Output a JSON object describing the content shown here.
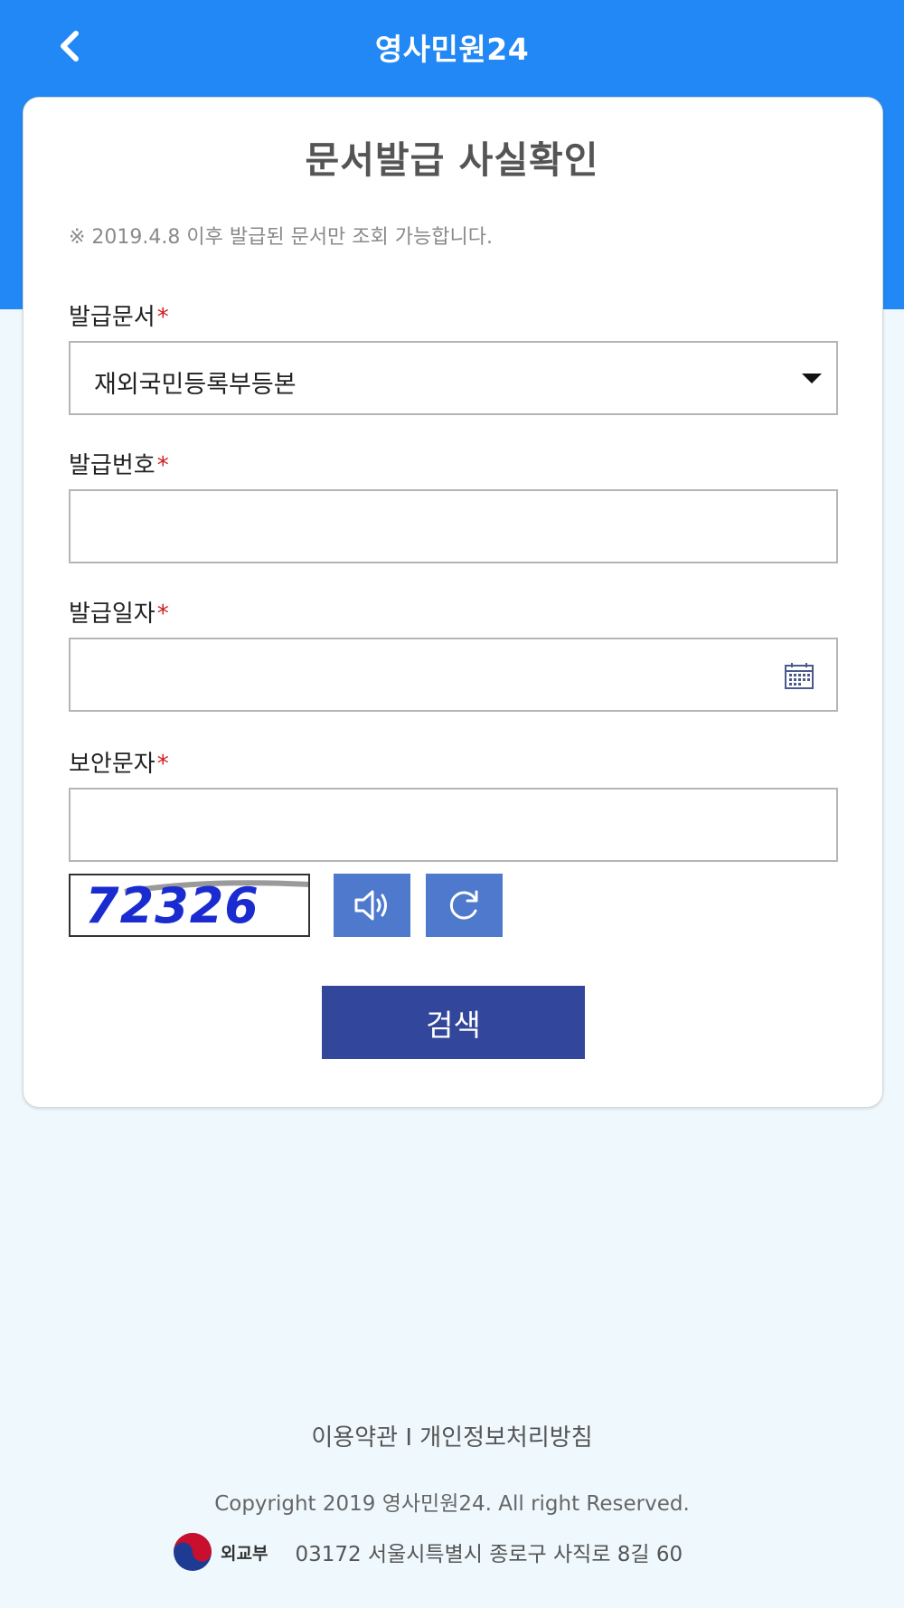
{
  "header": {
    "title": "영사민원24",
    "back_icon": "chevron-left-icon"
  },
  "card": {
    "title": "문서발급 사실확인",
    "notice": "※ 2019.4.8 이후 발급된 문서만 조회 가능합니다."
  },
  "form": {
    "doc_type": {
      "label": "발급문서",
      "required_mark": "*",
      "value": "재외국민등록부등본"
    },
    "doc_number": {
      "label": "발급번호",
      "required_mark": "*",
      "value": ""
    },
    "issue_date": {
      "label": "발급일자",
      "required_mark": "*",
      "value": "",
      "icon": "calendar-icon"
    },
    "captcha_input": {
      "label": "보안문자",
      "required_mark": "*",
      "value": ""
    },
    "captcha": {
      "text": "72326",
      "audio_icon": "speaker-icon",
      "refresh_icon": "refresh-icon"
    },
    "search_label": "검색"
  },
  "footer": {
    "terms": "이용약관",
    "separator": "I",
    "privacy": "개인정보처리방침",
    "copyright": "Copyright 2019 영사민원24. All right Reserved.",
    "ministry": "외교부",
    "address": "03172 서울시특별시 종로구 사직로 8길 60"
  },
  "colors": {
    "header_blue": "#2288f5",
    "button_navy": "#32469b",
    "captcha_button": "#4e79cc",
    "required_red": "#d21c1c",
    "background": "#eff9fd"
  }
}
